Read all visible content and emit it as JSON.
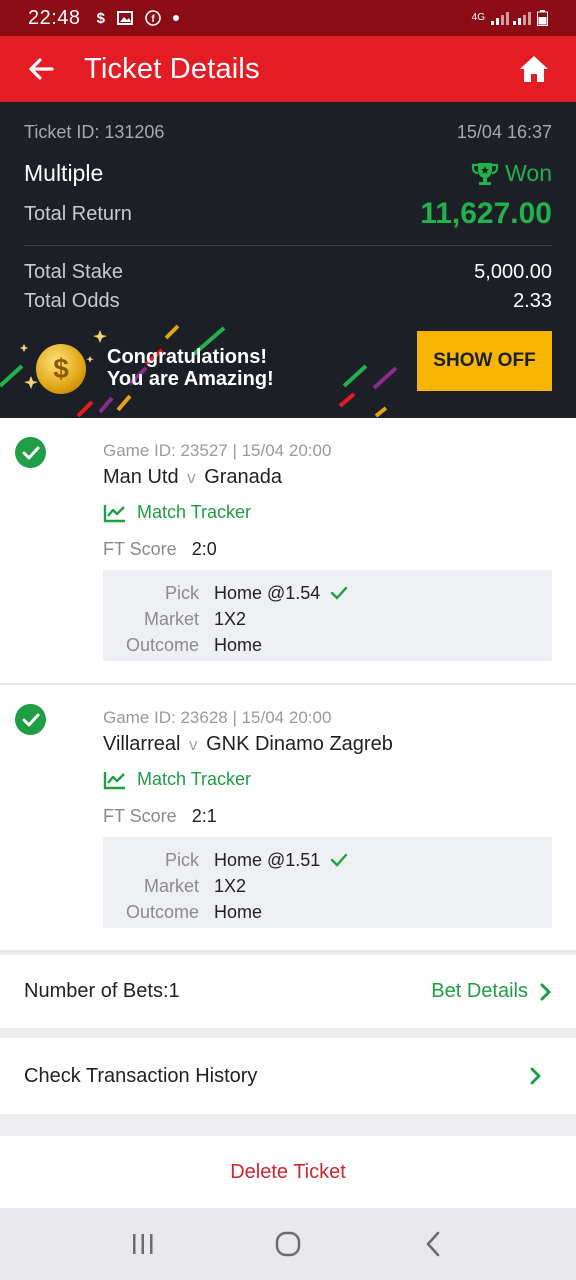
{
  "status_bar": {
    "time": "22:48",
    "network": "4G"
  },
  "header": {
    "title": "Ticket Details"
  },
  "summary": {
    "ticket_id": "Ticket ID: 131206",
    "date": "15/04 16:37",
    "bet_type": "Multiple",
    "status": "Won",
    "total_return_label": "Total Return",
    "total_return": "11,627.00",
    "total_stake_label": "Total Stake",
    "total_stake": "5,000.00",
    "total_odds_label": "Total Odds",
    "total_odds": "2.33",
    "promo_line1": "Congratulations!",
    "promo_line2": "You are Amazing!",
    "show_off_label": "SHOW OFF"
  },
  "games": [
    {
      "game_id": "Game ID: 23527 | 15/04 20:00",
      "home": "Man Utd",
      "vs": "v",
      "away": "Granada",
      "tracker_label": "Match Tracker",
      "ft_label": "FT Score",
      "ft_score": "2:0",
      "pick_label": "Pick",
      "pick": "Home @1.54",
      "market_label": "Market",
      "market": "1X2",
      "outcome_label": "Outcome",
      "outcome": "Home"
    },
    {
      "game_id": "Game ID: 23628 | 15/04 20:00",
      "home": "Villarreal",
      "vs": "v",
      "away": "GNK Dinamo Zagreb",
      "tracker_label": "Match Tracker",
      "ft_label": "FT Score",
      "ft_score": "2:1",
      "pick_label": "Pick",
      "pick": "Home @1.51",
      "market_label": "Market",
      "market": "1X2",
      "outcome_label": "Outcome",
      "outcome": "Home"
    }
  ],
  "footer": {
    "num_bets": "Number of Bets:1",
    "bet_details": "Bet Details",
    "transaction_history": "Check Transaction History",
    "delete_ticket": "Delete Ticket"
  },
  "colors": {
    "status_bar": "#8b0c14",
    "app_bar": "#e41d25",
    "summary_bg": "#1c1f26",
    "won_green": "#22b24c",
    "accent_green": "#1f9e44",
    "show_off": "#f7b500",
    "delete_red": "#d3262f"
  },
  "icons": [
    "back-arrow-icon",
    "home-icon",
    "trophy-icon",
    "coin-icon",
    "check-circle-icon",
    "chart-line-icon",
    "checkmark-icon",
    "chevron-right-icon",
    "recents-icon",
    "home-circle-icon",
    "back-chevron-icon"
  ]
}
